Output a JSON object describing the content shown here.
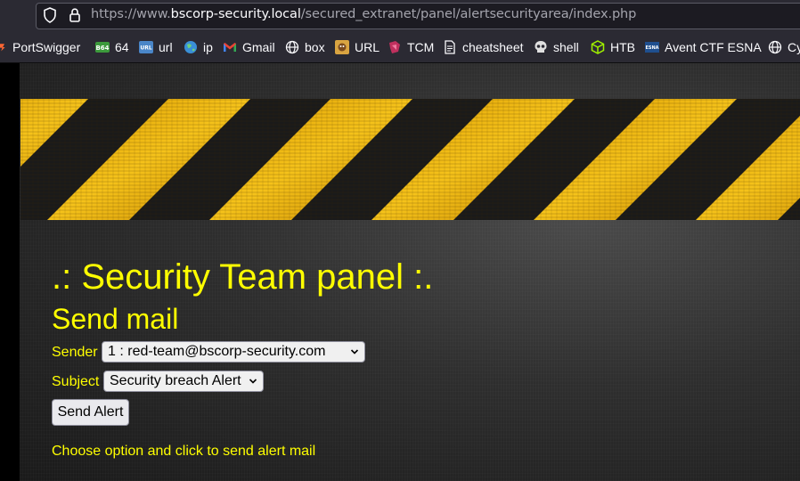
{
  "url": {
    "protocol": "https://www.",
    "domain": "bscorp-security.local",
    "path": "/secured_extranet/panel/alertsecurityarea/index.php"
  },
  "bookmarks": [
    {
      "label": "PortSwigger",
      "icon": "portswigger-icon"
    },
    {
      "label": "64",
      "icon": "base64-icon"
    },
    {
      "label": "url",
      "icon": "url-encode-icon"
    },
    {
      "label": "ip",
      "icon": "globe-ip-icon"
    },
    {
      "label": "Gmail",
      "icon": "gmail-icon"
    },
    {
      "label": "box",
      "icon": "globe-icon"
    },
    {
      "label": "URL",
      "icon": "url-tool-icon"
    },
    {
      "label": "TCM",
      "icon": "tcm-icon"
    },
    {
      "label": "cheatsheet",
      "icon": "document-icon"
    },
    {
      "label": "shell",
      "icon": "skull-icon"
    },
    {
      "label": "HTB",
      "icon": "htb-cube-icon"
    },
    {
      "label": "Avent CTF ESNA",
      "icon": "esna-icon"
    },
    {
      "label": "Cy",
      "icon": "globe-icon"
    }
  ],
  "page": {
    "title": ".: Security Team panel :.",
    "subtitle": "Send mail",
    "sender_label": "Sender",
    "sender_value": "1 : red-team@bscorp-security.com",
    "subject_label": "Subject",
    "subject_value": "Security breach Alert",
    "send_button": "Send Alert",
    "hint": "Choose option and click to send alert mail"
  },
  "colors": {
    "accent_text": "#ffff00",
    "stripe_yellow": "#f2b705",
    "browser_chrome": "#2b2a33"
  }
}
